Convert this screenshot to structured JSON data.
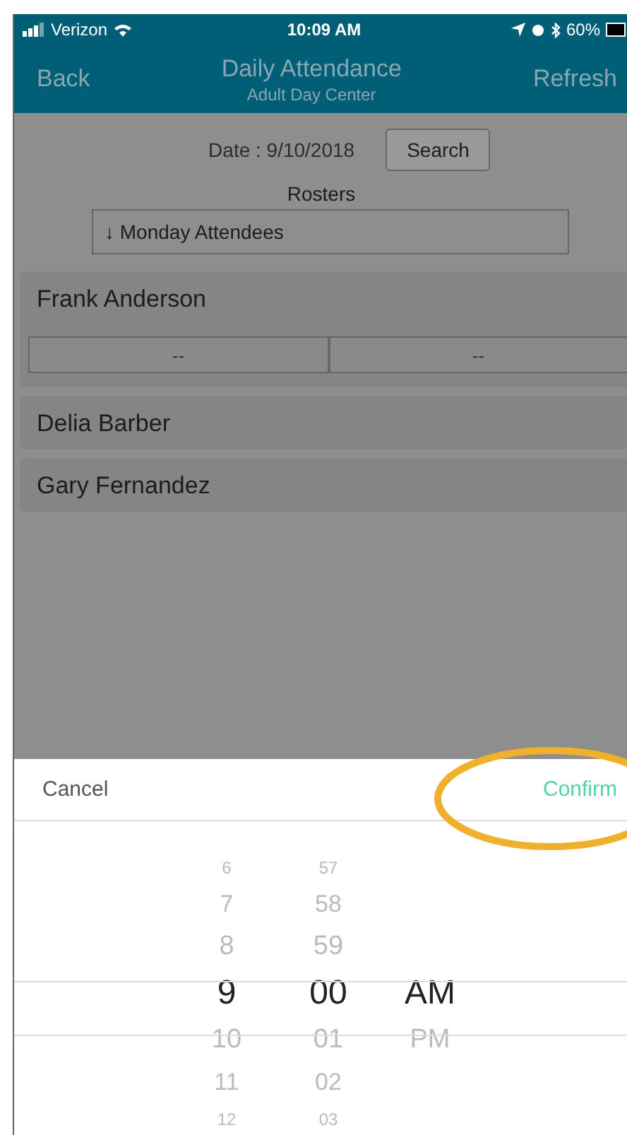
{
  "status_bar": {
    "carrier": "Verizon",
    "time": "10:09 AM",
    "battery": "60%"
  },
  "nav": {
    "back": "Back",
    "title": "Daily Attendance",
    "subtitle": "Adult Day Center",
    "refresh": "Refresh"
  },
  "filter": {
    "date_label": "Date : 9/10/2018",
    "search": "Search",
    "rosters_label": "Rosters",
    "roster": "↓ Monday Attendees"
  },
  "attendees": [
    {
      "name": "Frank Anderson",
      "times": [
        "--",
        "--"
      ]
    },
    {
      "name": "Delia Barber"
    },
    {
      "name": "Gary Fernandez"
    }
  ],
  "picker": {
    "cancel": "Cancel",
    "confirm": "Confirm",
    "confirm_highlighted": true,
    "columns": [
      {
        "items": [
          {
            "label": "6",
            "selected": false
          },
          {
            "label": "7",
            "selected": false
          },
          {
            "label": "8",
            "selected": false
          },
          {
            "label": "9",
            "selected": true
          },
          {
            "label": "10",
            "selected": false
          },
          {
            "label": "11",
            "selected": false
          },
          {
            "label": "12",
            "selected": false
          }
        ]
      },
      {
        "items": [
          {
            "label": "57",
            "selected": false
          },
          {
            "label": "58",
            "selected": false
          },
          {
            "label": "59",
            "selected": false
          },
          {
            "label": "00",
            "selected": true
          },
          {
            "label": "01",
            "selected": false
          },
          {
            "label": "02",
            "selected": false
          },
          {
            "label": "03",
            "selected": false
          }
        ]
      },
      {
        "items": [
          {
            "label": "AM",
            "selected": true
          },
          {
            "label": "PM",
            "selected": false
          }
        ]
      }
    ]
  }
}
